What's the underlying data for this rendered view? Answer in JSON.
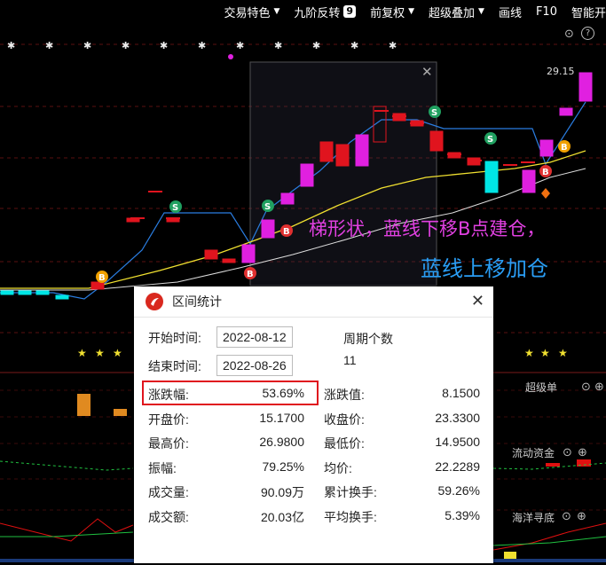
{
  "toolbar": {
    "items": [
      {
        "label": "交易特色",
        "dropdown": true
      },
      {
        "label": "九阶反转",
        "badge": "9"
      },
      {
        "label": "前复权",
        "dropdown": true
      },
      {
        "label": "超级叠加",
        "dropdown": true
      },
      {
        "label": "画线"
      },
      {
        "label": "F10"
      },
      {
        "label": "智能开"
      }
    ]
  },
  "chart": {
    "price_label": "29.15",
    "annotation_1": "梯形状，蓝线下移B点建仓，",
    "annotation_2": "蓝线上移加仓",
    "indicator_labels": {
      "super_order": "超级单",
      "flow": "流动资金",
      "ocean": "海洋寻底"
    },
    "colors": {
      "up": "#e0141e",
      "up_hollow": "#e020e0",
      "down": "#00e5e5",
      "blue_line": "#2a7de1",
      "yellow_line": "#f0e030",
      "selection": "#3a3a55"
    }
  },
  "dialog": {
    "title": "区间统计",
    "start_label": "开始时间:",
    "start_value": "2022-08-12",
    "end_label": "结束时间:",
    "end_value": "2022-08-26",
    "period_label": "周期个数",
    "period_value": "11",
    "stats": [
      {
        "label": "涨跌幅:",
        "value": "53.69%",
        "label2": "涨跌值:",
        "value2": "8.1500"
      },
      {
        "label": "开盘价:",
        "value": "15.1700",
        "label2": "收盘价:",
        "value2": "23.3300"
      },
      {
        "label": "最高价:",
        "value": "26.9800",
        "label2": "最低价:",
        "value2": "14.9500"
      },
      {
        "label": "振幅:",
        "value": "79.25%",
        "label2": "均价:",
        "value2": "22.2289"
      },
      {
        "label": "成交量:",
        "value": "90.09万",
        "label2": "累计换手:",
        "value2": "59.26%"
      },
      {
        "label": "成交额:",
        "value": "20.03亿",
        "label2": "平均换手:",
        "value2": "5.39%"
      }
    ]
  }
}
